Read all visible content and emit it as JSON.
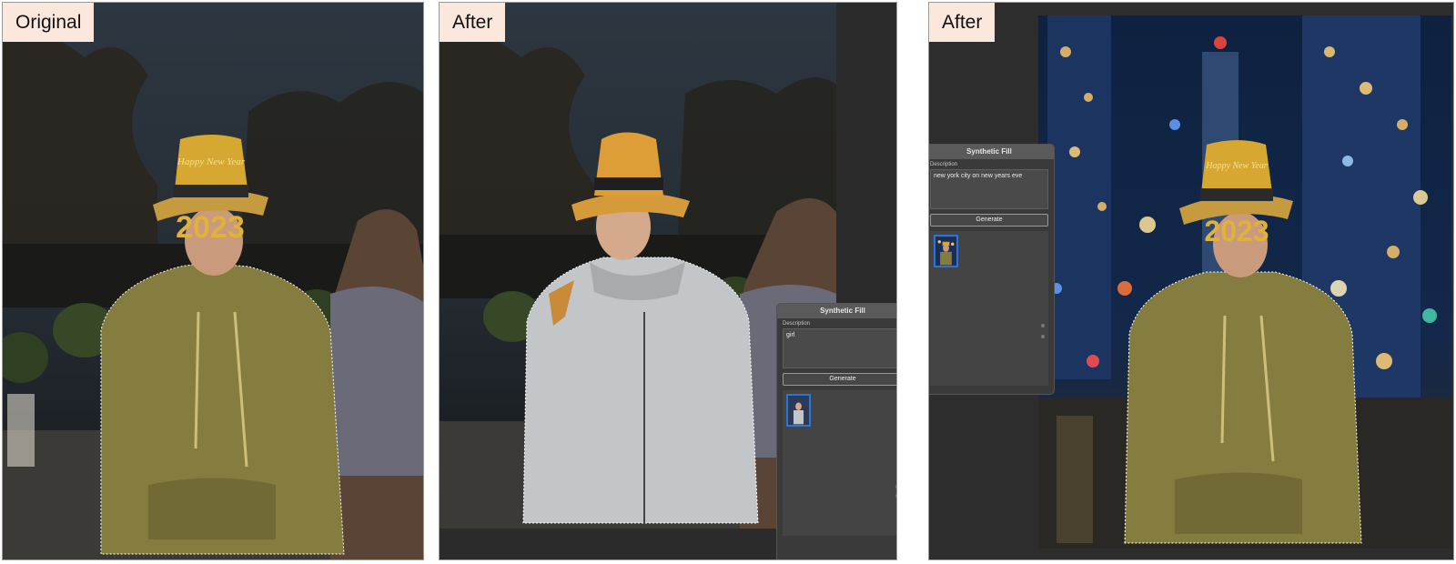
{
  "panels": [
    {
      "label": "Original"
    },
    {
      "label": "After",
      "dock": {
        "title": "Synthetic Fill",
        "description_label": "Description",
        "description_value": "girl",
        "generate_label": "Generate"
      }
    },
    {
      "label": "After",
      "dock": {
        "title": "Synthetic Fill",
        "description_label": "Description",
        "description_value": "new york city on new years eve",
        "generate_label": "Generate"
      }
    }
  ],
  "hat_text": "Happy New Year",
  "glasses_text": "2023",
  "colors": {
    "label_bg": "#fbe7dc",
    "hoodie": "#857d3f",
    "hat_gold": "#d6a832",
    "selection_border": "#ffffff",
    "thumb_border": "#2f74d0"
  }
}
